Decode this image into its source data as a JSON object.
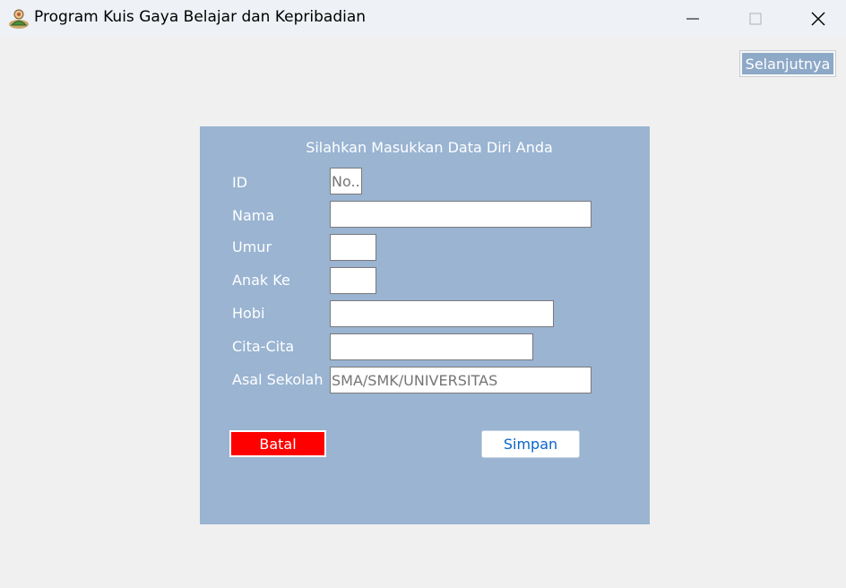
{
  "window": {
    "title": "Program Kuis Gaya Belajar dan Kepribadian",
    "controls": [
      "minimize",
      "maximize",
      "close"
    ]
  },
  "toolbar": {
    "next_label": "Selanjutnya"
  },
  "form": {
    "heading": "Silahkan Masukkan Data Diri Anda",
    "fields": {
      "id": {
        "label": "ID",
        "placeholder": "No..",
        "value": ""
      },
      "nama": {
        "label": "Nama",
        "value": ""
      },
      "umur": {
        "label": "Umur",
        "value": ""
      },
      "anak_ke": {
        "label": "Anak Ke",
        "value": ""
      },
      "hobi": {
        "label": "Hobi",
        "value": ""
      },
      "cita_cita": {
        "label": "Cita-Cita",
        "value": ""
      },
      "asal_sekolah": {
        "label": "Asal Sekolah",
        "placeholder": "SMA/SMK/UNIVERSITAS",
        "value": ""
      }
    },
    "cancel_label": "Batal",
    "save_label": "Simpan"
  },
  "colors": {
    "panel_background": "#9ab4d2",
    "cancel_button": "#ff0000",
    "save_text": "#0a64c8",
    "next_button": "#8ea9c8"
  }
}
